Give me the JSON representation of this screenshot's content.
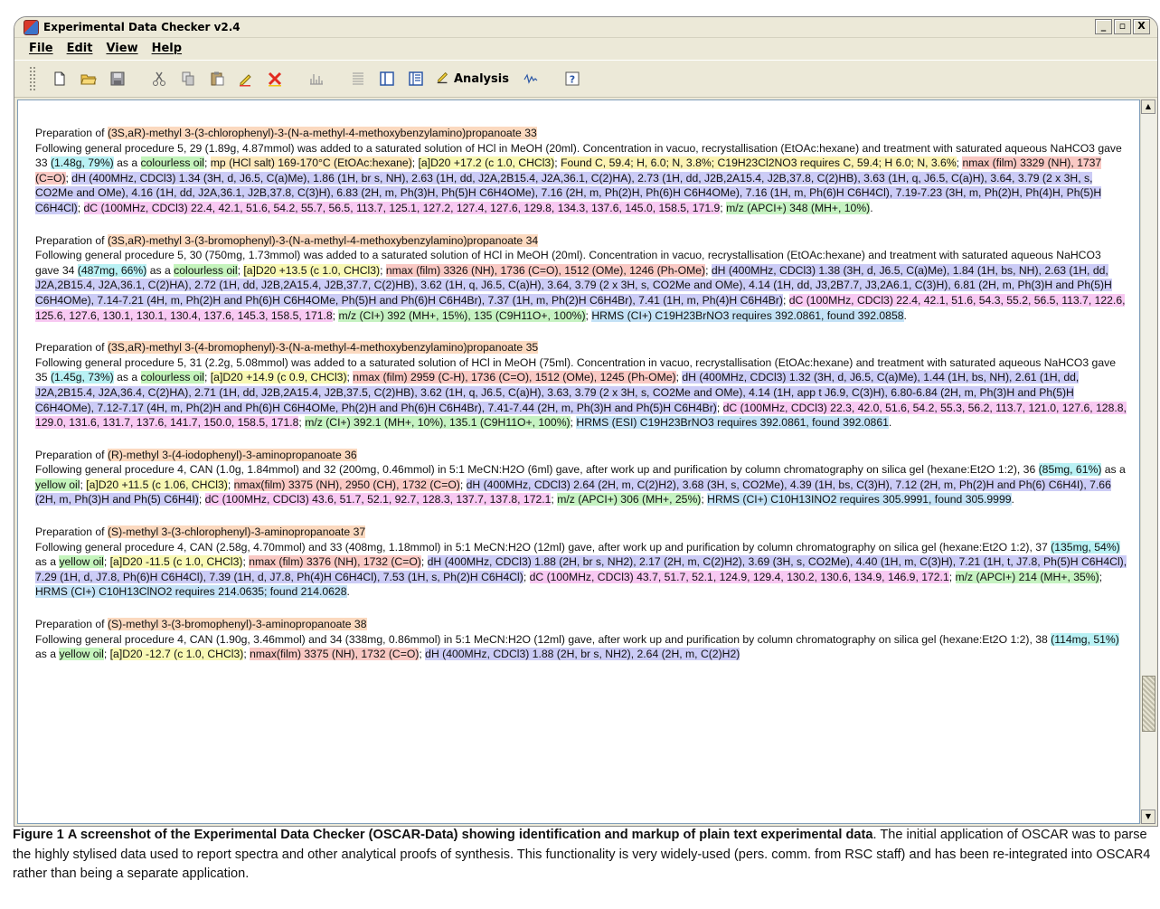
{
  "window": {
    "title": "Experimental Data Checker v2.4",
    "controls": [
      "_",
      "▫",
      "X"
    ]
  },
  "menu": [
    "File",
    "Edit",
    "View",
    "Help"
  ],
  "toolbar": {
    "icons": [
      "new-file-icon",
      "open-folder-icon",
      "save-icon",
      "cut-icon",
      "copy-icon",
      "paste-icon",
      "highlight-icon",
      "delete-icon",
      "spectrum-icon",
      "text-icon",
      "panel-icon",
      "list-panel-icon",
      "checkmark-icon",
      "chart-icon",
      "help-icon"
    ],
    "analysis_label": "Analysis"
  },
  "entries": [
    {
      "title": "Preparation of ",
      "name": "(3S,aR)-methyl 3-(3-chlorophenyl)-3-(N-a-methyl-4-methoxybenzylamino)propanoate 33",
      "body": [
        [
          "",
          "Following general procedure 5, 29 (1.89g, 4.87mmol) was added to a saturated solution of HCl in MeOH (20ml). Concentration in vacuo, recrystallisation (EtOAc:hexane) and treatment with saturated aqueous NaHCO3 gave 33 "
        ],
        [
          "yield",
          "(1.48g, 79%)"
        ],
        [
          "",
          " as a "
        ],
        [
          "state",
          "colourless oil"
        ],
        [
          "",
          "; "
        ],
        [
          "mp",
          "mp (HCl salt) 169-170°C (EtOAc:hexane)"
        ],
        [
          "",
          "; "
        ],
        [
          "rot",
          "[a]D20 +17.2 (c 1.0, CHCl3)"
        ],
        [
          "",
          "; "
        ],
        [
          "anal",
          "Found C, 59.4; H, 6.0; N, 3.8%; C19H23Cl2NO3 requires C, 59.4; H 6.0; N, 3.6%"
        ],
        [
          "",
          "; "
        ],
        [
          "ir",
          "nmax (film) 3329 (NH), 1737 (C=O)"
        ],
        [
          "",
          "; "
        ],
        [
          "hnmr",
          "dH (400MHz, CDCl3) 1.34 (3H, d, J6.5, C(a)Me), 1.86 (1H, br s, NH), 2.63 (1H, dd, J2A,2B15.4, J2A,36.1, C(2)HA), 2.73 (1H, dd, J2B,2A15.4, J2B,37.8, C(2)HB), 3.63 (1H, q, J6.5, C(a)H),  3.64, 3.79 (2 x 3H, s, CO2Me and OMe), 4.16 (1H, dd, J2A,36.1, J2B,37.8, C(3)H), 6.83 (2H, m, Ph(3)H, Ph(5)H C6H4OMe), 7.16 (2H, m, Ph(2)H, Ph(6)H C6H4OMe), 7.16 (1H, m, Ph(6)H C6H4Cl),  7.19-7.23 (3H, m, Ph(2)H, Ph(4)H, Ph(5)H C6H4Cl)"
        ],
        [
          "",
          "; "
        ],
        [
          "cnmr",
          "dC (100MHz, CDCl3) 22.4, 42.1, 51.6, 54.2, 55.7, 56.5, 113.7, 125.1, 127.2, 127.4, 127.6, 129.8, 134.3, 137.6, 145.0, 158.5, 171.9"
        ],
        [
          "",
          "; "
        ],
        [
          "ms",
          "m/z (APCI+) 348 (MH+, 10%)"
        ],
        [
          "",
          "."
        ]
      ]
    },
    {
      "title": "Preparation of ",
      "name": "(3S,aR)-methyl 3-(3-bromophenyl)-3-(N-a-methyl-4-methoxybenzylamino)propanoate 34",
      "body": [
        [
          "",
          "Following general procedure 5, 30 (750mg, 1.73mmol) was added to a saturated solution of HCl in MeOH (20ml). Concentration in vacuo, recrystallisation (EtOAc:hexane) and treatment with saturated aqueous NaHCO3 gave 34 "
        ],
        [
          "yield",
          "(487mg, 66%)"
        ],
        [
          "",
          " as a "
        ],
        [
          "state",
          "colourless oil"
        ],
        [
          "",
          "; "
        ],
        [
          "rot",
          "[a]D20 +13.5 (c 1.0, CHCl3)"
        ],
        [
          "",
          "; "
        ],
        [
          "ir",
          "nmax (film) 3326 (NH), 1736 (C=O), 1512 (OMe), 1246 (Ph-OMe)"
        ],
        [
          "",
          "; "
        ],
        [
          "hnmr",
          "dH (400MHz, CDCl3) 1.38 (3H, d, J6.5, C(a)Me), 1.84 (1H, bs, NH), 2.63 (1H, dd, J2A,2B15.4, J2A,36.1, C(2)HA), 2.72 (1H, dd, J2B,2A15.4, J2B,37.7, C(2)HB), 3.62 (1H, q, J6.5, C(a)H), 3.64, 3.79 (2 x 3H, s, CO2Me and OMe), 4.14 (1H, dd, J3,2B7.7, J3,2A6.1, C(3)H), 6.81 (2H, m, Ph(3)H and Ph(5)H C6H4OMe), 7.14-7.21 (4H, m, Ph(2)H and Ph(6)H C6H4OMe, Ph(5)H and Ph(6)H C6H4Br), 7.37 (1H, m, Ph(2)H C6H4Br), 7.41 (1H, m, Ph(4)H C6H4Br)"
        ],
        [
          "",
          "; "
        ],
        [
          "cnmr",
          "dC (100MHz, CDCl3) 22.4, 42.1, 51.6, 54.3, 55.2, 56.5, 113.7, 122.6, 125.6, 127.6, 130.1, 130.1, 130.4, 137.6, 145.3, 158.5, 171.8"
        ],
        [
          "",
          "; "
        ],
        [
          "ms",
          "m/z (CI+) 392 (MH+, 15%), 135 (C9H11O+, 100%)"
        ],
        [
          "",
          "; "
        ],
        [
          "hrms",
          "HRMS (CI+) C19H23BrNO3 requires 392.0861, found 392.0858"
        ],
        [
          "",
          "."
        ]
      ]
    },
    {
      "title": "Preparation of ",
      "name": "(3S,aR)-methyl 3-(4-bromophenyl)-3-(N-a-methyl-4-methoxybenzylamino)propanoate 35",
      "body": [
        [
          "",
          "Following general procedure 5, 31 (2.2g, 5.08mmol) was added to a saturated solution of HCl in MeOH (75ml). Concentration in vacuo, recrystallisation (EtOAc:hexane) and treatment with saturated aqueous NaHCO3 gave 35 "
        ],
        [
          "yield",
          "(1.45g, 73%)"
        ],
        [
          "",
          " as a "
        ],
        [
          "state",
          "colourless oil"
        ],
        [
          "",
          "; "
        ],
        [
          "rot",
          "[a]D20 +14.9 (c 0.9, CHCl3)"
        ],
        [
          "",
          "; "
        ],
        [
          "ir",
          "nmax (film) 2959 (C-H), 1736 (C=O), 1512 (OMe), 1245 (Ph-OMe)"
        ],
        [
          "",
          "; "
        ],
        [
          "hnmr",
          "dH (400MHz, CDCl3) 1.32 (3H, d, J6.5, C(a)Me), 1.44 (1H, bs, NH), 2.61 (1H, dd, J2A,2B15.4, J2A,36.4, C(2)HA), 2.71 (1H, dd, J2B,2A15.4, J2B,37.5, C(2)HB), 3.62 (1H, q, J6.5, C(a)H), 3.63, 3.79 (2 x 3H, s, CO2Me and OMe), 4.14 (1H, app t J6.9, C(3)H), 6.80-6.84  (2H, m, Ph(3)H and Ph(5)H C6H4OMe), 7.12-7.17 (4H, m, Ph(2)H and Ph(6)H C6H4OMe, Ph(2)H and Ph(6)H C6H4Br), 7.41-7.44 (2H, m, Ph(3)H and Ph(5)H C6H4Br)"
        ],
        [
          "",
          "; "
        ],
        [
          "cnmr",
          "dC (100MHz, CDCl3) 22.3, 42.0, 51.6, 54.2, 55.3, 56.2, 113.7, 121.0, 127.6, 128.8, 129.0, 131.6, 131.7, 137.6, 141.7, 150.0, 158.5, 171.8"
        ],
        [
          "",
          "; "
        ],
        [
          "ms",
          "m/z (CI+) 392.1 (MH+, 10%), 135.1 (C9H11O+, 100%)"
        ],
        [
          "",
          "; "
        ],
        [
          "hrms",
          "HRMS (ESI) C19H23BrNO3 requires 392.0861, found 392.0861"
        ],
        [
          "",
          "."
        ]
      ]
    },
    {
      "title": "Preparation of ",
      "name": "(R)-methyl 3-(4-iodophenyl)-3-aminopropanoate 36",
      "body": [
        [
          "",
          "Following general procedure 4, CAN (1.0g, 1.84mmol) and 32 (200mg, 0.46mmol) in 5:1 MeCN:H2O (6ml) gave, after work up and purification by column chromatography on silica gel (hexane:Et2O 1:2), 36 "
        ],
        [
          "yield",
          "(85mg, 61%)"
        ],
        [
          "",
          " as a "
        ],
        [
          "state",
          "yellow oil"
        ],
        [
          "",
          "; "
        ],
        [
          "rot",
          "[a]D20 +11.5 (c 1.06, CHCl3)"
        ],
        [
          "",
          "; "
        ],
        [
          "ir",
          "nmax(film) 3375 (NH), 2950 (CH), 1732 (C=O)"
        ],
        [
          "",
          "; "
        ],
        [
          "hnmr",
          "dH (400MHz, CDCl3) 2.64 (2H, m, C(2)H2), 3.68 (3H, s, CO2Me), 4.39 (1H, bs, C(3)H), 7.12 (2H, m, Ph(2)H and Ph(6) C6H4I), 7.66 (2H, m, Ph(3)H and Ph(5) C6H4I)"
        ],
        [
          "",
          "; "
        ],
        [
          "cnmr",
          "dC (100MHz, CDCl3) 43.6, 51.7, 52.1,  92.7, 128.3, 137.7, 137.8, 172.1"
        ],
        [
          "",
          "; "
        ],
        [
          "ms",
          "m/z (APCI+) 306 (MH+, 25%)"
        ],
        [
          "",
          "; "
        ],
        [
          "hrms",
          "HRMS (CI+) C10H13INO2 requires 305.9991, found 305.9999"
        ],
        [
          "",
          "."
        ]
      ]
    },
    {
      "title": "Preparation of ",
      "name": "(S)-methyl 3-(3-chlorophenyl)-3-aminopropanoate 37",
      "body": [
        [
          "",
          "Following general procedure 4, CAN (2.58g, 4.70mmol) and 33 (408mg, 1.18mmol) in 5:1 MeCN:H2O (12ml) gave, after work up and purification by column chromatography on silica gel (hexane:Et2O 1:2), 37 "
        ],
        [
          "yield",
          "(135mg, 54%)"
        ],
        [
          "",
          " as a "
        ],
        [
          "state",
          "yellow oil"
        ],
        [
          "",
          "; "
        ],
        [
          "rot",
          "[a]D20 -11.5 (c 1.0, CHCl3)"
        ],
        [
          "",
          "; "
        ],
        [
          "ir",
          "nmax (film) 3376 (NH), 1732 (C=O)"
        ],
        [
          "",
          "; "
        ],
        [
          "hnmr",
          "dH (400MHz, CDCl3) 1.88 (2H, br s, NH2), 2.17 (2H, m, C(2)H2), 3.69 (3H, s, CO2Me), 4.40  (1H, m, C(3)H), 7.21 (1H, t, J7.8, Ph(5)H C6H4Cl), 7.29 (1H, d, J7.8, Ph(6)H C6H4Cl),  7.39 (1H, d, J7.8, Ph(4)H C6H4Cl), 7.53 (1H, s, Ph(2)H C6H4Cl)"
        ],
        [
          "",
          "; "
        ],
        [
          "cnmr",
          "dC (100MHz, CDCl3) 43.7, 51.7, 52.1, 124.9, 129.4, 130.2, 130.6, 134.9, 146.9, 172.1"
        ],
        [
          "",
          "; "
        ],
        [
          "ms",
          "m/z (APCI+) 214 (MH+, 35%)"
        ],
        [
          "",
          "; "
        ],
        [
          "hrms",
          "HRMS (CI+) C10H13ClNO2 requires 214.0635; found 214.0628"
        ],
        [
          "",
          "."
        ]
      ]
    },
    {
      "title": "Preparation of ",
      "name": "(S)-methyl 3-(3-bromophenyl)-3-aminopropanoate 38",
      "body": [
        [
          "",
          "Following general procedure 4, CAN (1.90g, 3.46mmol) and 34 (338mg, 0.86mmol) in 5:1 MeCN:H2O (12ml) gave, after work up and purification by column chromatography on silica gel (hexane:Et2O 1:2), 38 "
        ],
        [
          "yield",
          "(114mg, 51%)"
        ],
        [
          "",
          " as a "
        ],
        [
          "state",
          "yellow oil"
        ],
        [
          "",
          "; "
        ],
        [
          "rot",
          "[a]D20 -12.7 (c 1.0, CHCl3)"
        ],
        [
          "",
          "; "
        ],
        [
          "ir",
          "nmax(film) 3375 (NH), 1732 (C=O)"
        ],
        [
          "",
          "; "
        ],
        [
          "hnmr",
          "dH (400MHz, CDCl3) 1.88 (2H, br s, NH2), 2.64 (2H, m, C(2)H2)"
        ]
      ]
    }
  ],
  "caption": {
    "label": "Figure 1",
    "title": "A screenshot of the Experimental Data Checker (OSCAR-Data) showing identification and markup of plain text experimental data",
    "text": ". The initial application of OSCAR was to parse the highly stylised data used to report spectra and other analytical proofs of synthesis. This functionality is very widely-used (pers. comm. from RSC staff) and has been re-integrated into OSCAR4 rather than being a separate application."
  },
  "colors": {
    "name": "#fbd9bf",
    "yield": "#b9f1f4",
    "state": "#c4f4bc",
    "mp": "#fde9bd",
    "rot": "#f8f8b4",
    "anal": "#fbf3b4",
    "ir": "#f9c9c4",
    "hnmr": "#ccccf6",
    "cnmr": "#f8c9f2",
    "ms": "#c6f2c2",
    "hrms": "#c4e2f6"
  }
}
